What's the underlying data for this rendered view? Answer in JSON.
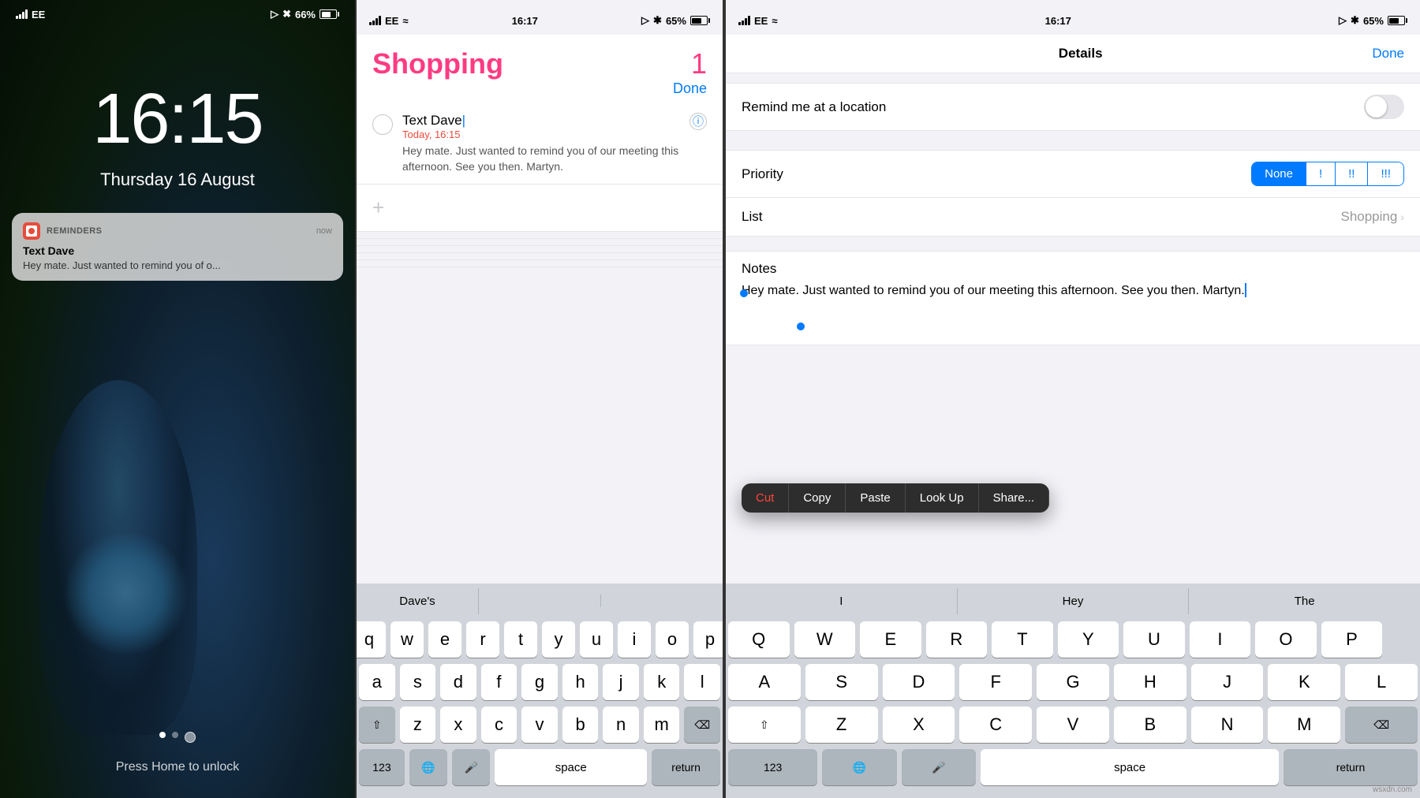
{
  "phone1": {
    "status": {
      "carrier": "EE",
      "battery": "66%",
      "time": "16:15"
    },
    "time": "16:15",
    "date": "Thursday 16 August",
    "notification": {
      "app": "REMINDERS",
      "time_label": "now",
      "title": "Text Dave",
      "body": "Hey mate. Just wanted to remind you of o..."
    },
    "home_prompt": "Press Home to unlock"
  },
  "phone2": {
    "status": {
      "carrier": "EE",
      "time": "16:17",
      "battery": "65%"
    },
    "app_title": "Shopping",
    "count": "1",
    "done_label": "Done",
    "reminder": {
      "title": "Text Dave",
      "date": "Today, 16:15",
      "body": "Hey mate. Just wanted to remind you of our meeting this afternoon. See you then.  Martyn."
    },
    "autocomplete": [
      "Dave's",
      "",
      ""
    ],
    "keyboard_rows": [
      [
        "q",
        "w",
        "e",
        "r",
        "t",
        "y",
        "u",
        "i",
        "o",
        "p"
      ],
      [
        "a",
        "s",
        "d",
        "f",
        "g",
        "h",
        "j",
        "k",
        "l"
      ],
      [
        "⇧",
        "z",
        "x",
        "c",
        "v",
        "b",
        "n",
        "m",
        "⌫"
      ],
      [
        "123",
        "🌐",
        "🎤",
        "space",
        "return"
      ]
    ]
  },
  "phone3": {
    "status": {
      "carrier": "EE",
      "time": "16:17",
      "battery": "65%"
    },
    "nav": {
      "title": "Details",
      "done_label": "Done"
    },
    "location_label": "Remind me at a location",
    "priority_label": "Priority",
    "priority_options": [
      "None",
      "!",
      "!!",
      "!!!"
    ],
    "priority_active": "None",
    "list_label": "List",
    "list_value": "Shopping",
    "notes_label": "Notes",
    "notes_text": "Hey mate. Just wanted to remind you of our meeting this afternoon. See you then. Martyn.",
    "context_menu": [
      "Cut",
      "Copy",
      "Paste",
      "Look Up",
      "Share..."
    ],
    "autocomplete": [
      "I",
      "Hey",
      "The"
    ],
    "keyboard_rows": [
      [
        "Q",
        "W",
        "E",
        "R",
        "T",
        "Y",
        "U",
        "I",
        "O",
        "P"
      ],
      [
        "A",
        "S",
        "D",
        "F",
        "G",
        "H",
        "J",
        "K",
        "L"
      ],
      [
        "⇧",
        "Z",
        "X",
        "C",
        "V",
        "B",
        "N",
        "M",
        "⌫"
      ],
      [
        "123",
        "🌐",
        "🎤",
        "space",
        "return"
      ]
    ]
  },
  "attribution": "wsxdn.com"
}
